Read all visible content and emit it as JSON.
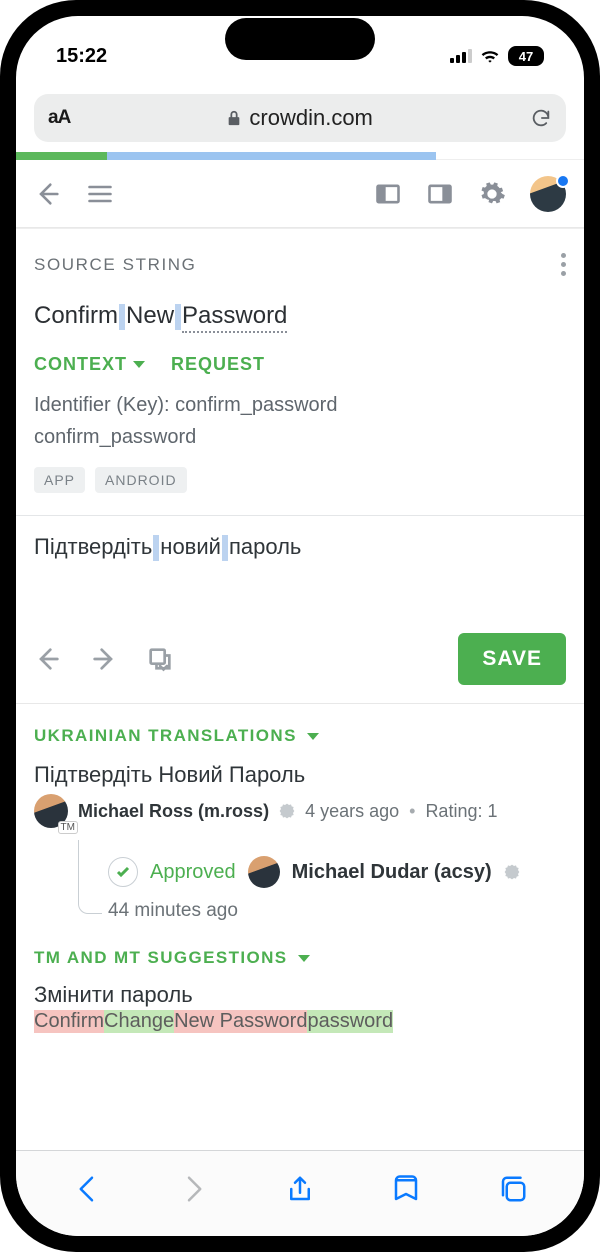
{
  "status": {
    "time": "15:22",
    "battery": "47"
  },
  "browser": {
    "domain": "crowdin.com"
  },
  "header": {
    "source_string_label": "SOURCE STRING",
    "context_label": "CONTEXT",
    "request_label": "REQUEST"
  },
  "source": {
    "words": [
      "Confirm",
      "New",
      "Password"
    ],
    "identifier_line": "Identifier (Key): confirm_password",
    "key_value": "confirm_password",
    "tags": [
      "APP",
      "ANDROID"
    ]
  },
  "translation_input": {
    "words": [
      "Підтвердіть",
      "новий",
      "пароль"
    ],
    "save_label": "SAVE"
  },
  "translations_section": {
    "heading": "UKRAINIAN TRANSLATIONS",
    "items": [
      {
        "text": "Підтвердіть Новий Пароль",
        "author": "Michael Ross (m.ross)",
        "age": "4 years ago",
        "rating_label": "Rating: 1",
        "tm_badge": "TM"
      }
    ],
    "approved": {
      "label": "Approved",
      "by": "Michael Dudar (acsy)",
      "age": "44 minutes ago"
    }
  },
  "tm_section": {
    "heading": "TM AND MT SUGGESTIONS",
    "suggestion": "Змінити пароль",
    "diff": {
      "del1": "Confirm",
      "add1": "Change",
      "keep": " New Password",
      "del2": "",
      "add2": "password"
    }
  }
}
